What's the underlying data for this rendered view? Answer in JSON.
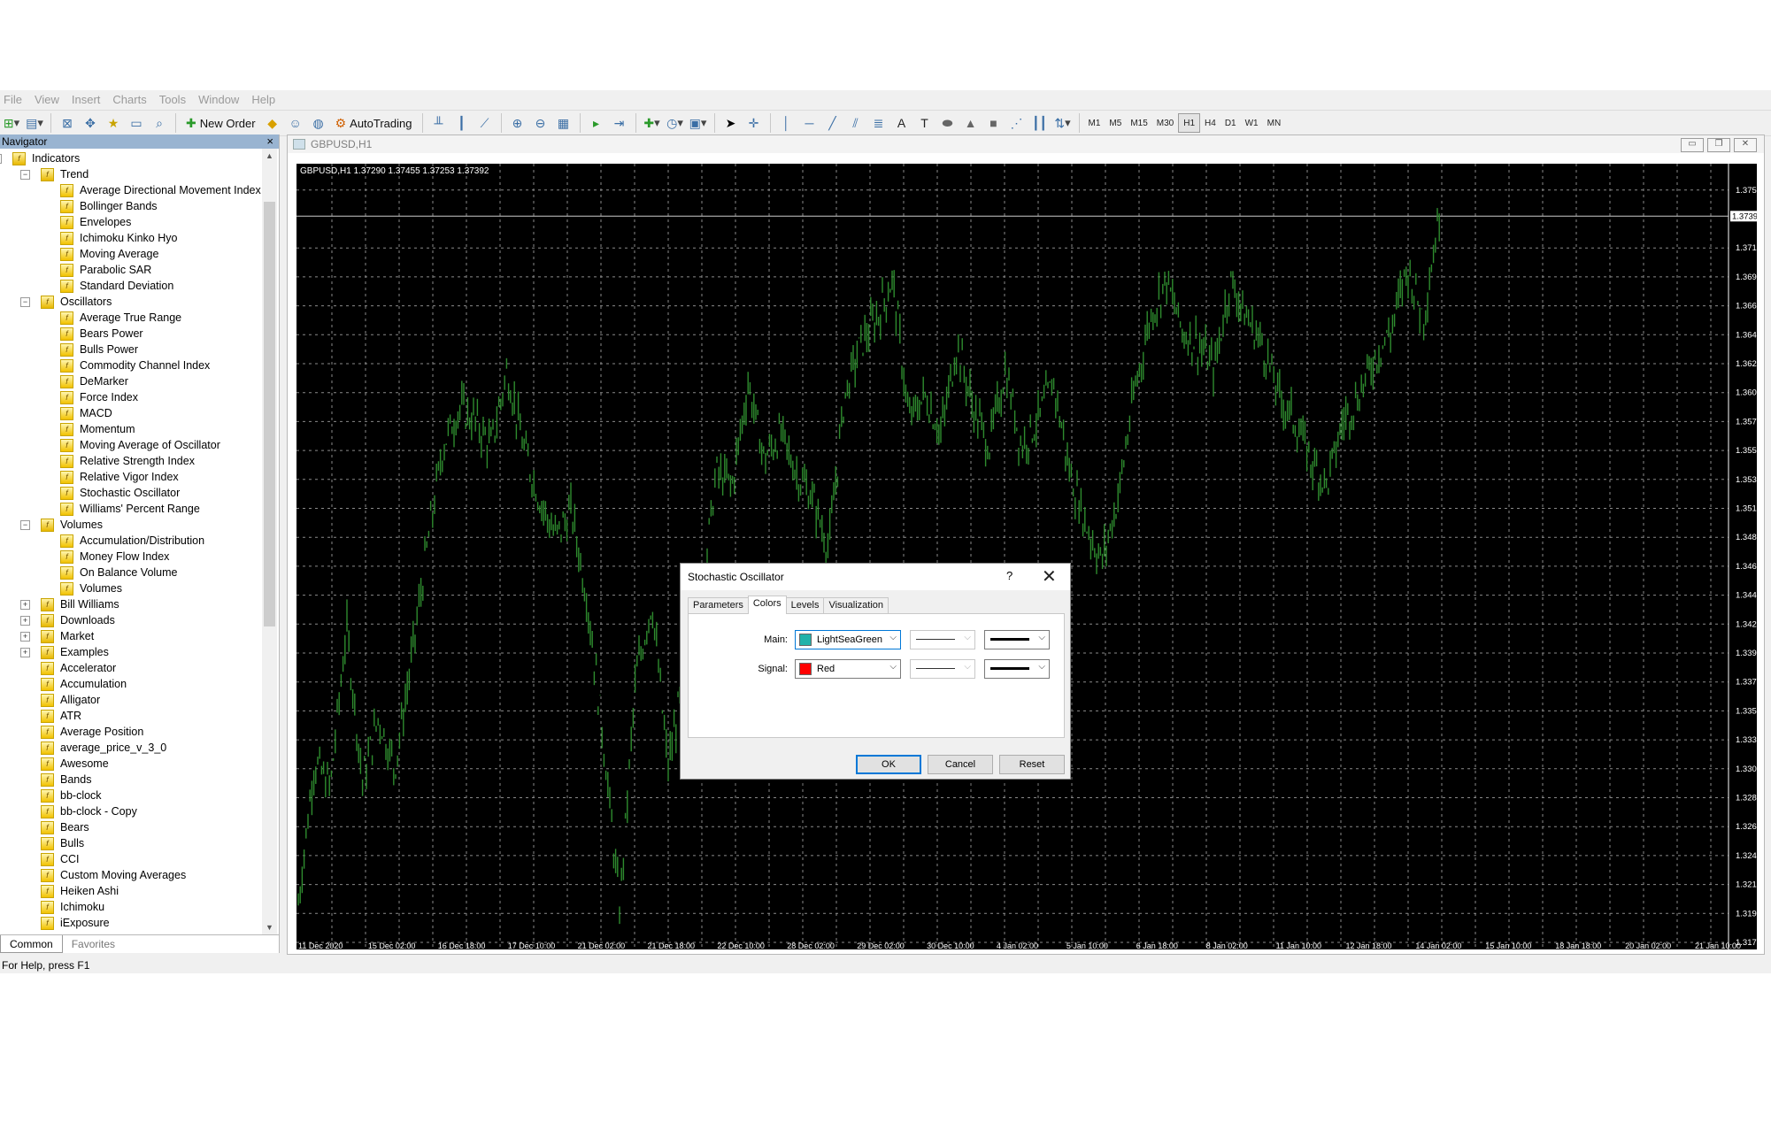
{
  "menu": [
    "File",
    "View",
    "Insert",
    "Charts",
    "Tools",
    "Window",
    "Help"
  ],
  "toolbar": {
    "new_order": "New Order",
    "auto_trading": "AutoTrading",
    "timeframes": [
      "M1",
      "M5",
      "M15",
      "M30",
      "H1",
      "H4",
      "D1",
      "W1",
      "MN"
    ],
    "active_timeframe": "H1"
  },
  "navigator": {
    "title": "Navigator",
    "close": "×",
    "tabs": [
      "Common",
      "Favorites"
    ],
    "tree": [
      {
        "label": "Indicators",
        "level": 0,
        "toggle": "−",
        "folder": true
      },
      {
        "label": "Trend",
        "level": 1,
        "toggle": "−",
        "folder": true
      },
      {
        "label": "Average Directional Movement Index",
        "level": 2
      },
      {
        "label": "Bollinger Bands",
        "level": 2
      },
      {
        "label": "Envelopes",
        "level": 2
      },
      {
        "label": "Ichimoku Kinko Hyo",
        "level": 2
      },
      {
        "label": "Moving Average",
        "level": 2
      },
      {
        "label": "Parabolic SAR",
        "level": 2
      },
      {
        "label": "Standard Deviation",
        "level": 2
      },
      {
        "label": "Oscillators",
        "level": 1,
        "toggle": "−",
        "folder": true
      },
      {
        "label": "Average True Range",
        "level": 2
      },
      {
        "label": "Bears Power",
        "level": 2
      },
      {
        "label": "Bulls Power",
        "level": 2
      },
      {
        "label": "Commodity Channel Index",
        "level": 2
      },
      {
        "label": "DeMarker",
        "level": 2
      },
      {
        "label": "Force Index",
        "level": 2
      },
      {
        "label": "MACD",
        "level": 2
      },
      {
        "label": "Momentum",
        "level": 2
      },
      {
        "label": "Moving Average of Oscillator",
        "level": 2
      },
      {
        "label": "Relative Strength Index",
        "level": 2
      },
      {
        "label": "Relative Vigor Index",
        "level": 2
      },
      {
        "label": "Stochastic Oscillator",
        "level": 2
      },
      {
        "label": "Williams' Percent Range",
        "level": 2
      },
      {
        "label": "Volumes",
        "level": 1,
        "toggle": "−",
        "folder": true
      },
      {
        "label": "Accumulation/Distribution",
        "level": 2
      },
      {
        "label": "Money Flow Index",
        "level": 2
      },
      {
        "label": "On Balance Volume",
        "level": 2
      },
      {
        "label": "Volumes",
        "level": 2
      },
      {
        "label": "Bill Williams",
        "level": 1,
        "toggle": "+",
        "folder": true
      },
      {
        "label": "Downloads",
        "level": 1,
        "toggle": "+",
        "folder": true
      },
      {
        "label": "Market",
        "level": 1,
        "toggle": "+",
        "folder": true
      },
      {
        "label": "Examples",
        "level": 1,
        "toggle": "+",
        "folder": true
      },
      {
        "label": "Accelerator",
        "level": 1
      },
      {
        "label": "Accumulation",
        "level": 1
      },
      {
        "label": "Alligator",
        "level": 1
      },
      {
        "label": "ATR",
        "level": 1
      },
      {
        "label": "Average Position",
        "level": 1
      },
      {
        "label": "average_price_v_3_0",
        "level": 1
      },
      {
        "label": "Awesome",
        "level": 1
      },
      {
        "label": "Bands",
        "level": 1
      },
      {
        "label": "bb-clock",
        "level": 1
      },
      {
        "label": "bb-clock - Copy",
        "level": 1
      },
      {
        "label": "Bears",
        "level": 1
      },
      {
        "label": "Bulls",
        "level": 1
      },
      {
        "label": "CCI",
        "level": 1
      },
      {
        "label": "Custom Moving Averages",
        "level": 1
      },
      {
        "label": "Heiken Ashi",
        "level": 1
      },
      {
        "label": "Ichimoku",
        "level": 1
      },
      {
        "label": "iExposure",
        "level": 1
      }
    ]
  },
  "chart_window": {
    "title": "GBPUSD,H1",
    "info": "GBPUSD,H1  1.37290 1.37455 1.37253 1.37392"
  },
  "chart_data": {
    "type": "bar",
    "title": "GBPUSD,H1",
    "ohlc_last": {
      "open": 1.3729,
      "high": 1.37455,
      "low": 1.37253,
      "close": 1.37392
    },
    "current_price": "1.37392",
    "ylim": [
      1.31745,
      1.37745
    ],
    "y_ticks": [
      "1.37595",
      "1.37145",
      "1.36920",
      "1.36695",
      "1.36470",
      "1.36245",
      "1.36020",
      "1.35795",
      "1.35570",
      "1.35345",
      "1.35120",
      "1.34895",
      "1.34670",
      "1.34445",
      "1.34220",
      "1.33995",
      "1.33770",
      "1.33545",
      "1.33320",
      "1.33095",
      "1.32870",
      "1.32645",
      "1.32420",
      "1.32195",
      "1.31970",
      "1.31745"
    ],
    "x_ticks": [
      "11 Dec 2020",
      "15 Dec 02:00",
      "16 Dec 18:00",
      "17 Dec 10:00",
      "21 Dec 02:00",
      "21 Dec 18:00",
      "22 Dec 10:00",
      "28 Dec 02:00",
      "29 Dec 02:00",
      "30 Dec 10:00",
      "4 Jan 02:00",
      "5 Jan 10:00",
      "6 Jan 18:00",
      "8 Jan 02:00",
      "11 Jan 10:00",
      "12 Jan 18:00",
      "14 Jan 02:00",
      "15 Jan 10:00",
      "18 Jan 18:00",
      "20 Jan 02:00",
      "21 Jan 10:00"
    ],
    "price_path": [
      1.3205,
      1.3315,
      1.3295,
      1.342,
      1.33,
      1.335,
      1.331,
      1.339,
      1.348,
      1.356,
      1.359,
      1.358,
      1.356,
      1.362,
      1.356,
      1.352,
      1.349,
      1.351,
      1.344,
      1.333,
      1.32,
      1.338,
      1.344,
      1.331,
      1.338,
      1.343,
      1.354,
      1.353,
      1.361,
      1.355,
      1.357,
      1.354,
      1.352,
      1.348,
      1.36,
      1.364,
      1.366,
      1.369,
      1.358,
      1.36,
      1.357,
      1.364,
      1.359,
      1.356,
      1.362,
      1.356,
      1.358,
      1.361,
      1.354,
      1.35,
      1.347,
      1.352,
      1.36,
      1.366,
      1.369,
      1.365,
      1.364,
      1.362,
      1.369,
      1.366,
      1.364,
      1.36,
      1.358,
      1.355,
      1.353,
      1.358,
      1.36,
      1.363,
      1.365,
      1.37,
      1.366,
      1.374
    ],
    "bar_color": "#2e8b2e",
    "grid": true
  },
  "dialog": {
    "title": "Stochastic Oscillator",
    "help": "?",
    "close": "✕",
    "tabs": [
      "Parameters",
      "Colors",
      "Levels",
      "Visualization"
    ],
    "active_tab": "Colors",
    "main_label": "Main:",
    "main_color_name": "LightSeaGreen",
    "main_color": "#20b2aa",
    "signal_label": "Signal:",
    "signal_color_name": "Red",
    "signal_color": "#ff0000",
    "ok": "OK",
    "cancel": "Cancel",
    "reset": "Reset"
  },
  "status": {
    "text": "For Help, press F1"
  }
}
